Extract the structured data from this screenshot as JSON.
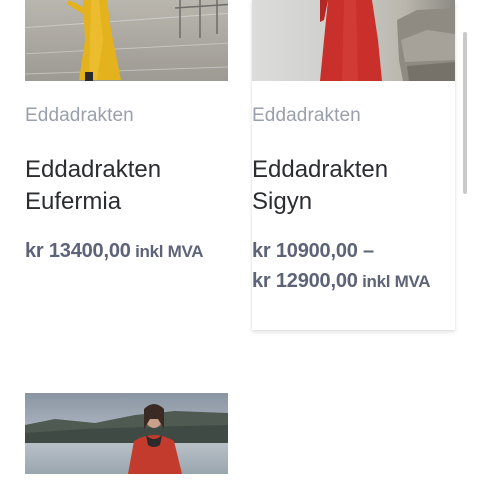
{
  "products": [
    {
      "category": "Eddadrakten",
      "title_line1": "Eddadrakten",
      "title_line2": "Eufermia",
      "price_line1": "kr 13400,00",
      "price_line1_suffix": " inkl MVA",
      "image_desc": "woman in yellow dress"
    },
    {
      "category": "Eddadrakten",
      "title_line1": "Eddadrakten",
      "title_line2": "Sigyn",
      "price_line1": "kr 10900,00 –",
      "price_line2": "kr 12900,00",
      "price_line2_suffix": " inkl MVA",
      "image_desc": "woman in red dress"
    },
    {
      "image_desc": "woman in red cape by fjord"
    }
  ],
  "colors": {
    "category": "#9aa0ab",
    "title": "#2b2d31",
    "price": "#5d6478"
  }
}
